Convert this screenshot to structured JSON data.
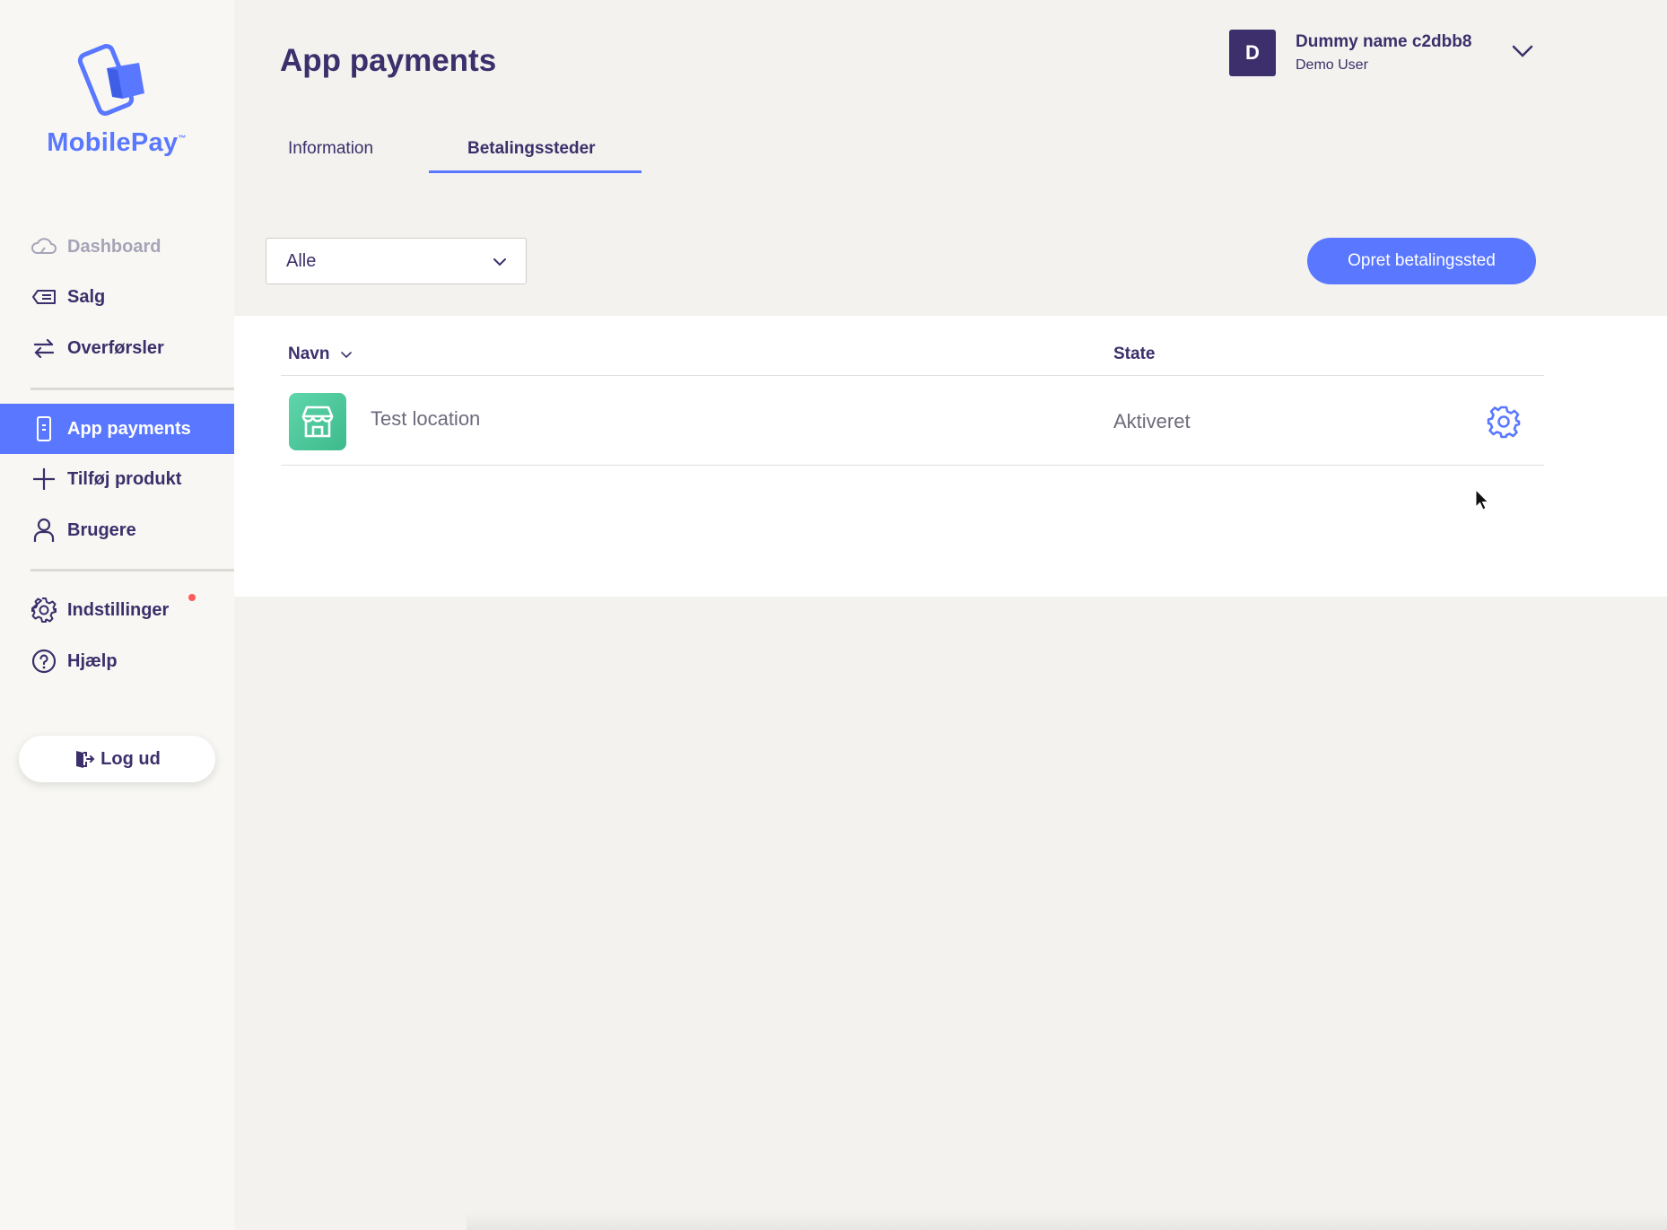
{
  "brand": {
    "name": "MobilePay",
    "trademark": "™",
    "accent_color": "#5a78ff",
    "primary_text_color": "#3c2f6b"
  },
  "sidebar": {
    "items": [
      {
        "label": "Dashboard",
        "icon": "cloud-icon",
        "state": "disabled"
      },
      {
        "label": "Salg",
        "icon": "ticket-icon"
      },
      {
        "label": "Overførsler",
        "icon": "transfer-arrows-icon"
      },
      {
        "label": "App payments",
        "icon": "phone-icon",
        "state": "active"
      },
      {
        "label": "Tilføj produkt",
        "icon": "plus-icon"
      },
      {
        "label": "Brugere",
        "icon": "user-icon"
      },
      {
        "label": "Indstillinger",
        "icon": "gear-icon",
        "notification": true
      },
      {
        "label": "Hjælp",
        "icon": "question-circle-icon"
      }
    ],
    "logout_label": "Log ud"
  },
  "header": {
    "title": "App payments",
    "user": {
      "initial": "D",
      "name": "Dummy name c2dbb8",
      "role": "Demo User"
    }
  },
  "tabs": [
    {
      "label": "Information",
      "active": false
    },
    {
      "label": "Betalingssteder",
      "active": true
    }
  ],
  "controls": {
    "filter_value": "Alle",
    "create_button_label": "Opret betalingssted"
  },
  "table": {
    "columns": [
      "Navn",
      "State"
    ],
    "rows": [
      {
        "name": "Test location",
        "state": "Aktiveret",
        "icon": "store-icon"
      }
    ]
  }
}
